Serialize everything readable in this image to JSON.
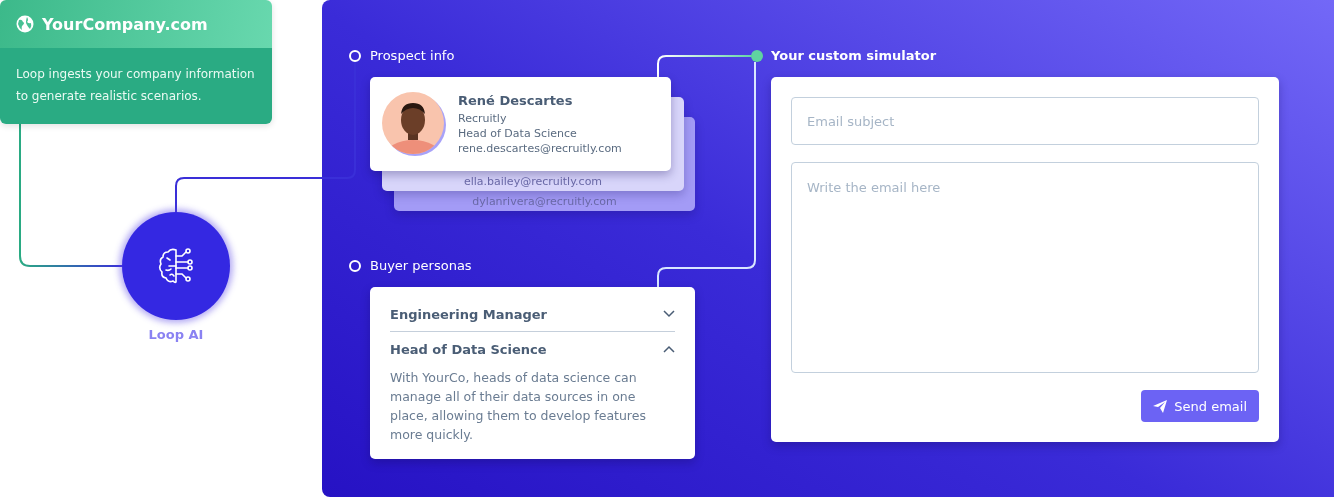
{
  "company": {
    "title": "YourCompany.com",
    "description": "Loop ingests your company information to generate realistic scenarios."
  },
  "hub": {
    "label": "Loop AI"
  },
  "prospect": {
    "label": "Prospect info",
    "name": "René Descartes",
    "company": "Recruitly",
    "role": "Head of Data Science",
    "email": "rene.descartes@recruitly.com",
    "stacked_emails": [
      "ella.bailey@recruitly.com",
      "dylanrivera@recruitly.com"
    ]
  },
  "personas": {
    "label": "Buyer personas",
    "items": [
      {
        "title": "Engineering Manager",
        "expanded": false
      },
      {
        "title": "Head of Data Science",
        "expanded": true,
        "description": "With YourCo, heads of data science can manage all of their data sources in one place, allowing them to develop features more quickly."
      }
    ]
  },
  "simulator": {
    "label": "Your custom simulator",
    "subject": {
      "placeholder": "Email subject"
    },
    "body": {
      "placeholder": "Write the email here"
    },
    "send_button": "Send email"
  }
}
